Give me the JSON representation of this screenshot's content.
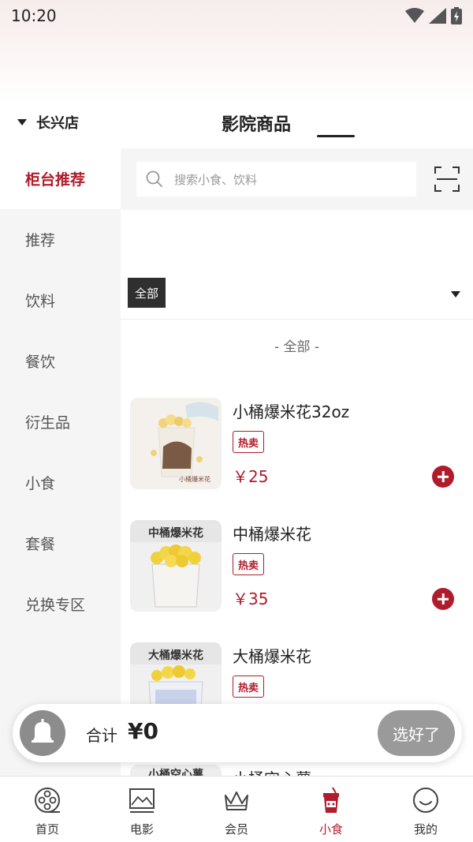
{
  "status_bar": {
    "time": "10:20"
  },
  "header": {
    "store": "长兴店",
    "title": "影院商品"
  },
  "sidebar": {
    "items": [
      {
        "label": "柜台推荐",
        "active": true
      },
      {
        "label": "推荐",
        "active": false
      },
      {
        "label": "饮料",
        "active": false
      },
      {
        "label": "餐饮",
        "active": false
      },
      {
        "label": "衍生品",
        "active": false
      },
      {
        "label": "小食",
        "active": false
      },
      {
        "label": "套餐",
        "active": false
      },
      {
        "label": "兑换专区",
        "active": false
      }
    ]
  },
  "search": {
    "placeholder": "搜索小食、饮料"
  },
  "filter": {
    "selected": "全部"
  },
  "section": {
    "label": "- 全部 -"
  },
  "products": [
    {
      "name": "小桶爆米花32oz",
      "badge": "热卖",
      "price": "￥25",
      "image_caption": "小桶爆米花"
    },
    {
      "name": "中桶爆米花",
      "badge": "热卖",
      "price": "￥35",
      "image_caption": "中桶爆米花"
    },
    {
      "name": "大桶爆米花",
      "badge": "热卖",
      "price": "",
      "image_caption": "大桶爆米花"
    },
    {
      "name": "小桶空心薯",
      "badge": "",
      "price": "",
      "image_caption": "小桶空心薯"
    }
  ],
  "cart": {
    "total_label": "合计",
    "total_value": "¥0",
    "done_label": "选好了"
  },
  "bottom_nav": [
    {
      "label": "首页",
      "icon": "film-reel-icon",
      "active": false
    },
    {
      "label": "电影",
      "icon": "picture-icon",
      "active": false
    },
    {
      "label": "会员",
      "icon": "crown-icon",
      "active": false
    },
    {
      "label": "小食",
      "icon": "drink-cup-icon",
      "active": true
    },
    {
      "label": "我的",
      "icon": "smiley-icon",
      "active": false
    }
  ],
  "colors": {
    "accent": "#b01c2c",
    "sidebar_bg": "#f5f5f5"
  }
}
